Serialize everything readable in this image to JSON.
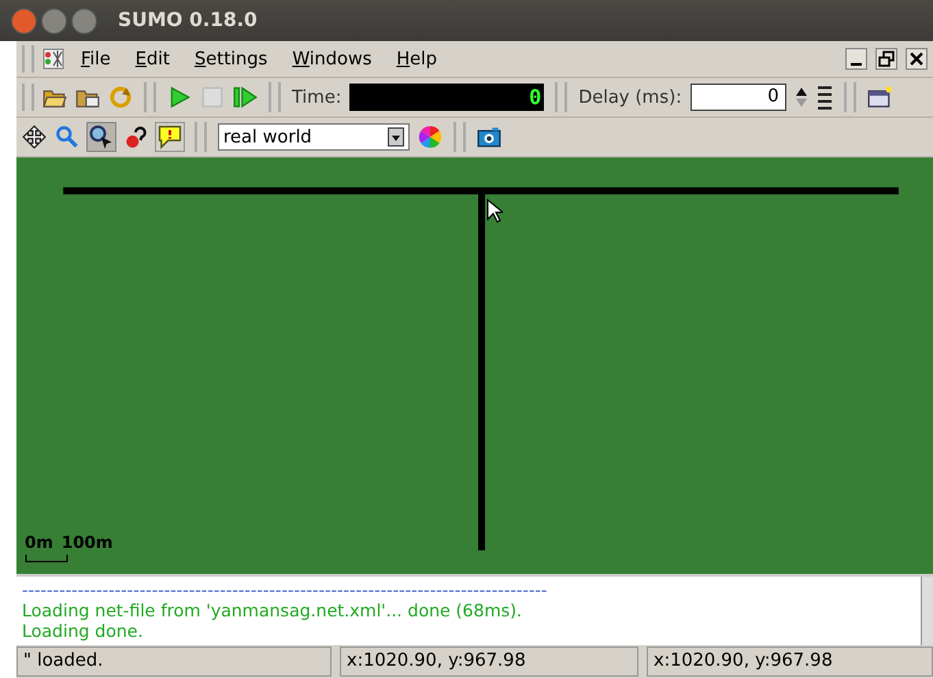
{
  "window": {
    "title": "SUMO 0.18.0"
  },
  "menu": [
    "File",
    "Edit",
    "Settings",
    "Windows",
    "Help"
  ],
  "simulation_toolbar": {
    "time_label": "Time:",
    "time_value": "0",
    "delay_label": "Delay (ms):",
    "delay_value": "0"
  },
  "view_toolbar": {
    "scheme": "real world",
    "locate_selected": true
  },
  "scale": {
    "start": "0m",
    "end": "100m"
  },
  "log": [
    {
      "kind": "separator",
      "text": "-------------------------------------------------------------------------------------"
    },
    {
      "kind": "message",
      "text": "Loading net-file from 'yanmansag.net.xml'...  done (68ms)."
    },
    {
      "kind": "message",
      "text": "Loading done."
    }
  ],
  "status_bar": [
    "\" loaded.",
    "x:1020.90, y:967.98",
    "x:1020.90, y:967.98"
  ]
}
